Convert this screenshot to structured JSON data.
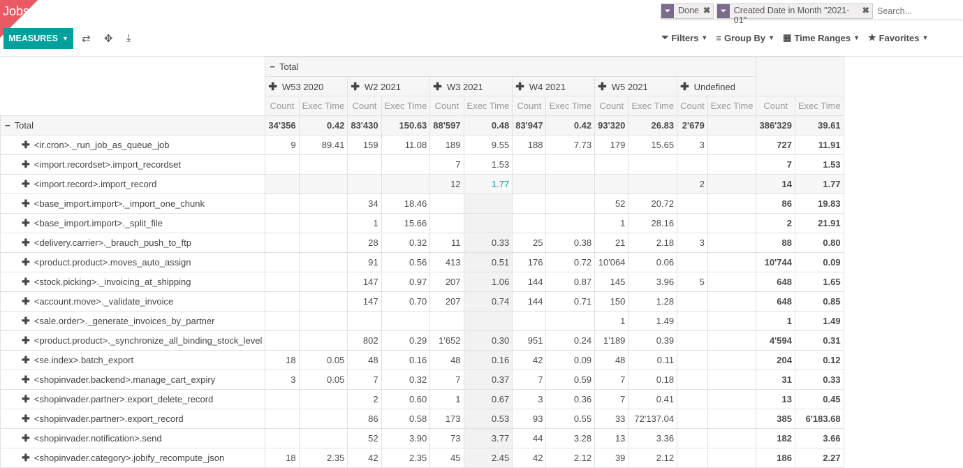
{
  "app": {
    "title": "Jobs"
  },
  "search": {
    "facets": [
      {
        "label": "Done"
      },
      {
        "label": "Created Date in Month \"2021-01\""
      }
    ],
    "placeholder": "Search..."
  },
  "toolbar": {
    "measures_label": "MEASURES",
    "filters_label": "Filters",
    "groupby_label": "Group By",
    "timeranges_label": "Time Ranges",
    "favorites_label": "Favorites"
  },
  "pivot": {
    "top_header": "Total",
    "columns": [
      "W53 2020",
      "W2 2021",
      "W3 2021",
      "W4 2021",
      "W5 2021",
      "Undefined"
    ],
    "measures": [
      "Count",
      "Exec Time"
    ],
    "total_label": "Total",
    "rows": [
      {
        "label": "Total",
        "values": [
          "34'356",
          "0.42",
          "83'430",
          "150.63",
          "88'597",
          "0.48",
          "83'947",
          "0.42",
          "93'320",
          "26.83",
          "2'679",
          "",
          "386'329",
          "39.61"
        ]
      },
      {
        "label": "<ir.cron>._run_job_as_queue_job",
        "values": [
          "9",
          "89.41",
          "159",
          "11.08",
          "189",
          "9.55",
          "188",
          "7.73",
          "179",
          "15.65",
          "3",
          "",
          "727",
          "11.91"
        ]
      },
      {
        "label": "<import.recordset>.import_recordset",
        "values": [
          "",
          "",
          "",
          "",
          "7",
          "1.53",
          "",
          "",
          "",
          "",
          "",
          "",
          "7",
          "1.53"
        ]
      },
      {
        "label": "<import.record>.import_record",
        "values": [
          "",
          "",
          "",
          "",
          "12",
          "1.77",
          "",
          "",
          "",
          "",
          "2",
          "",
          "14",
          "1.77"
        ]
      },
      {
        "label": "<base_import.import>._import_one_chunk",
        "values": [
          "",
          "",
          "34",
          "18.46",
          "",
          "",
          "",
          "",
          "52",
          "20.72",
          "",
          "",
          "86",
          "19.83"
        ]
      },
      {
        "label": "<base_import.import>._split_file",
        "values": [
          "",
          "",
          "1",
          "15.66",
          "",
          "",
          "",
          "",
          "1",
          "28.16",
          "",
          "",
          "2",
          "21.91"
        ]
      },
      {
        "label": "<delivery.carrier>._brauch_push_to_ftp",
        "values": [
          "",
          "",
          "28",
          "0.32",
          "11",
          "0.33",
          "25",
          "0.38",
          "21",
          "2.18",
          "3",
          "",
          "88",
          "0.80"
        ]
      },
      {
        "label": "<product.product>.moves_auto_assign",
        "values": [
          "",
          "",
          "91",
          "0.56",
          "413",
          "0.51",
          "176",
          "0.72",
          "10'064",
          "0.06",
          "",
          "",
          "10'744",
          "0.09"
        ]
      },
      {
        "label": "<stock.picking>._invoicing_at_shipping",
        "values": [
          "",
          "",
          "147",
          "0.97",
          "207",
          "1.06",
          "144",
          "0.87",
          "145",
          "3.96",
          "5",
          "",
          "648",
          "1.65"
        ]
      },
      {
        "label": "<account.move>._validate_invoice",
        "values": [
          "",
          "",
          "147",
          "0.70",
          "207",
          "0.74",
          "144",
          "0.71",
          "150",
          "1.28",
          "",
          "",
          "648",
          "0.85"
        ]
      },
      {
        "label": "<sale.order>._generate_invoices_by_partner",
        "values": [
          "",
          "",
          "",
          "",
          "",
          "",
          "",
          "",
          "1",
          "1.49",
          "",
          "",
          "1",
          "1.49"
        ]
      },
      {
        "label": "<product.product>._synchronize_all_binding_stock_level",
        "values": [
          "",
          "",
          "802",
          "0.29",
          "1'652",
          "0.30",
          "951",
          "0.24",
          "1'189",
          "0.39",
          "",
          "",
          "4'594",
          "0.31"
        ]
      },
      {
        "label": "<se.index>.batch_export",
        "values": [
          "18",
          "0.05",
          "48",
          "0.16",
          "48",
          "0.16",
          "42",
          "0.09",
          "48",
          "0.11",
          "",
          "",
          "204",
          "0.12"
        ]
      },
      {
        "label": "<shopinvader.backend>.manage_cart_expiry",
        "values": [
          "3",
          "0.05",
          "7",
          "0.32",
          "7",
          "0.37",
          "7",
          "0.59",
          "7",
          "0.18",
          "",
          "",
          "31",
          "0.33"
        ]
      },
      {
        "label": "<shopinvader.partner>.export_delete_record",
        "values": [
          "",
          "",
          "2",
          "0.60",
          "1",
          "0.67",
          "3",
          "0.36",
          "7",
          "0.41",
          "",
          "",
          "13",
          "0.45"
        ]
      },
      {
        "label": "<shopinvader.partner>.export_record",
        "values": [
          "",
          "",
          "86",
          "0.58",
          "173",
          "0.53",
          "93",
          "0.55",
          "33",
          "72'137.04",
          "",
          "",
          "385",
          "6'183.68"
        ]
      },
      {
        "label": "<shopinvader.notification>.send",
        "values": [
          "",
          "",
          "52",
          "3.90",
          "73",
          "3.77",
          "44",
          "3.28",
          "13",
          "3.36",
          "",
          "",
          "182",
          "3.66"
        ]
      },
      {
        "label": "<shopinvader.category>.jobify_recompute_json",
        "values": [
          "18",
          "2.35",
          "42",
          "2.35",
          "45",
          "2.45",
          "42",
          "2.12",
          "39",
          "2.12",
          "",
          "",
          "186",
          "2.27"
        ]
      }
    ]
  }
}
